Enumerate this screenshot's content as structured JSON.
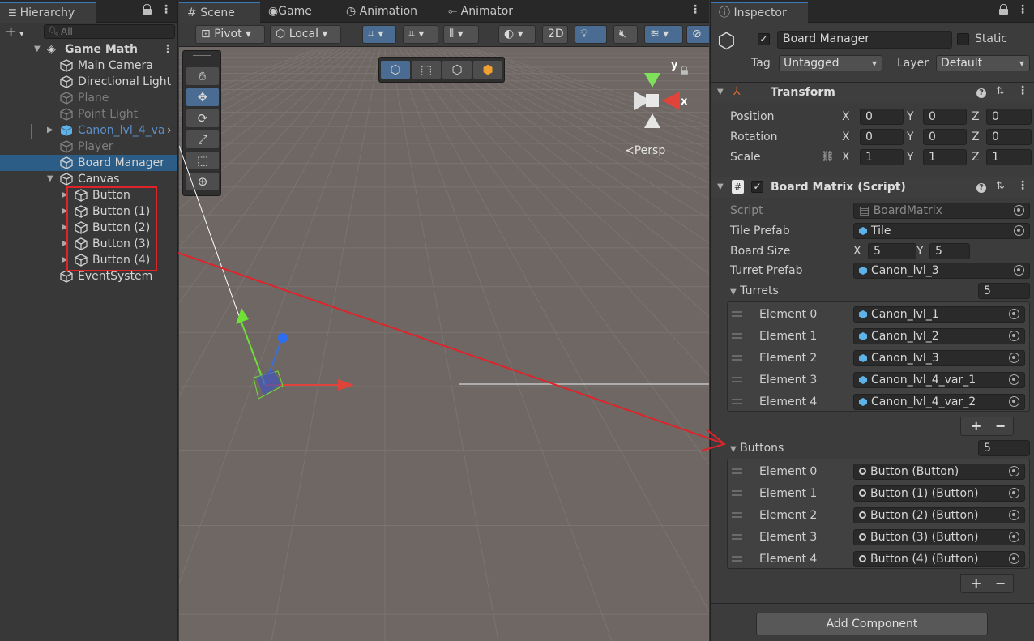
{
  "hierarchy": {
    "tab_label": "Hierarchy",
    "search_placeholder": "All",
    "scene_name": "Game Math",
    "items": [
      {
        "label": "Main Camera"
      },
      {
        "label": "Directional Light"
      },
      {
        "label": "Plane"
      },
      {
        "label": "Point Light"
      },
      {
        "label": "Canon_lvl_4_va"
      },
      {
        "label": "Player"
      },
      {
        "label": "Board Manager"
      },
      {
        "label": "Canvas"
      },
      {
        "label": "Button"
      },
      {
        "label": "Button (1)"
      },
      {
        "label": "Button (2)"
      },
      {
        "label": "Button (3)"
      },
      {
        "label": "Button (4)"
      },
      {
        "label": "EventSystem"
      }
    ]
  },
  "scene_view": {
    "tabs": [
      "Scene",
      "Game",
      "Animation",
      "Animator"
    ],
    "pivot_label": "Pivot",
    "local_label": "Local",
    "mode_2d_label": "2D",
    "persp_label": "Persp",
    "gizmo_axes": {
      "y": "y",
      "x": "x"
    }
  },
  "inspector": {
    "tab_label": "Inspector",
    "object_name": "Board Manager",
    "static_label": "Static",
    "tag_label": "Tag",
    "tag_value": "Untagged",
    "layer_label": "Layer",
    "layer_value": "Default",
    "transform": {
      "title": "Transform",
      "position_label": "Position",
      "rotation_label": "Rotation",
      "scale_label": "Scale",
      "position": {
        "x": "0",
        "y": "0",
        "z": "0"
      },
      "rotation": {
        "x": "0",
        "y": "0",
        "z": "0"
      },
      "scale": {
        "x": "1",
        "y": "1",
        "z": "1"
      },
      "axis_x": "X",
      "axis_y": "Y",
      "axis_z": "Z"
    },
    "board_matrix": {
      "title": "Board Matrix (Script)",
      "script_label": "Script",
      "script_value": "BoardMatrix",
      "tile_prefab_label": "Tile Prefab",
      "tile_prefab_value": "Tile",
      "board_size_label": "Board Size",
      "board_size_x": "5",
      "board_size_y": "5",
      "turret_prefab_label": "Turret Prefab",
      "turret_prefab_value": "Canon_lvl_3",
      "turrets_label": "Turrets",
      "turrets_count": "5",
      "turrets": [
        {
          "label": "Element 0",
          "value": "Canon_lvl_1"
        },
        {
          "label": "Element 1",
          "value": "Canon_lvl_2"
        },
        {
          "label": "Element 2",
          "value": "Canon_lvl_3"
        },
        {
          "label": "Element 3",
          "value": "Canon_lvl_4_var_1"
        },
        {
          "label": "Element 4",
          "value": "Canon_lvl_4_var_2"
        }
      ],
      "buttons_label": "Buttons",
      "buttons_count": "5",
      "buttons": [
        {
          "label": "Element 0",
          "value": "Button (Button)"
        },
        {
          "label": "Element 1",
          "value": "Button (1) (Button)"
        },
        {
          "label": "Element 2",
          "value": "Button (2) (Button)"
        },
        {
          "label": "Element 3",
          "value": "Button (3) (Button)"
        },
        {
          "label": "Element 4",
          "value": "Button (4) (Button)"
        }
      ],
      "add_symbol": "+",
      "remove_symbol": "−"
    },
    "add_component_label": "Add Component"
  },
  "colors": {
    "selection": "#2c5d87",
    "annotation_red": "#e0232a",
    "scene_bg": "#6e6763"
  }
}
